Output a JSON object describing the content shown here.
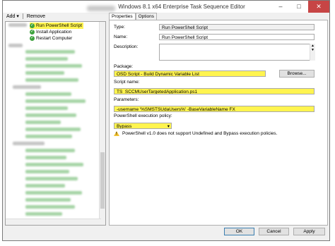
{
  "window": {
    "title": "Windows 8.1 x64 Enterprise Task Sequence Editor"
  },
  "toolbar": {
    "add_label": "Add ▾",
    "remove_label": "Remove"
  },
  "tree": {
    "items": [
      {
        "label": "Run PowerShell Script",
        "selected": true
      },
      {
        "label": "Install Application",
        "selected": false
      },
      {
        "label": "Restart Computer",
        "selected": false
      }
    ]
  },
  "tabs": [
    {
      "label": "Properties"
    },
    {
      "label": "Options"
    }
  ],
  "properties": {
    "type_label": "Type:",
    "type_value": "Run PowerShell Script",
    "name_label": "Name:",
    "name_value": "Run PowerShell Script",
    "description_label": "Description:",
    "description_value": "",
    "package_label": "Package:",
    "package_value": "OSD Script - Build Dynamic Variable List",
    "browse_label": "Browse...",
    "script_name_label": "Script name:",
    "script_name_value": "TS_SCCMUserTargetedApplication.ps1",
    "parameters_label": "Parameters:",
    "parameters_value": "-username '%SMSTSUdaUsers%' -BaseVariableName FX",
    "policy_label": "PowerShell execution policy:",
    "policy_value": "Bypass",
    "warning_text": "PowerShell v1.0 does not support Undefined and Bypass execution policies."
  },
  "footer": {
    "ok_label": "OK",
    "cancel_label": "Cancel",
    "apply_label": "Apply"
  },
  "colors": {
    "highlight": "#fff44f",
    "close": "#c74545",
    "check_icon": "#3fa33f"
  }
}
